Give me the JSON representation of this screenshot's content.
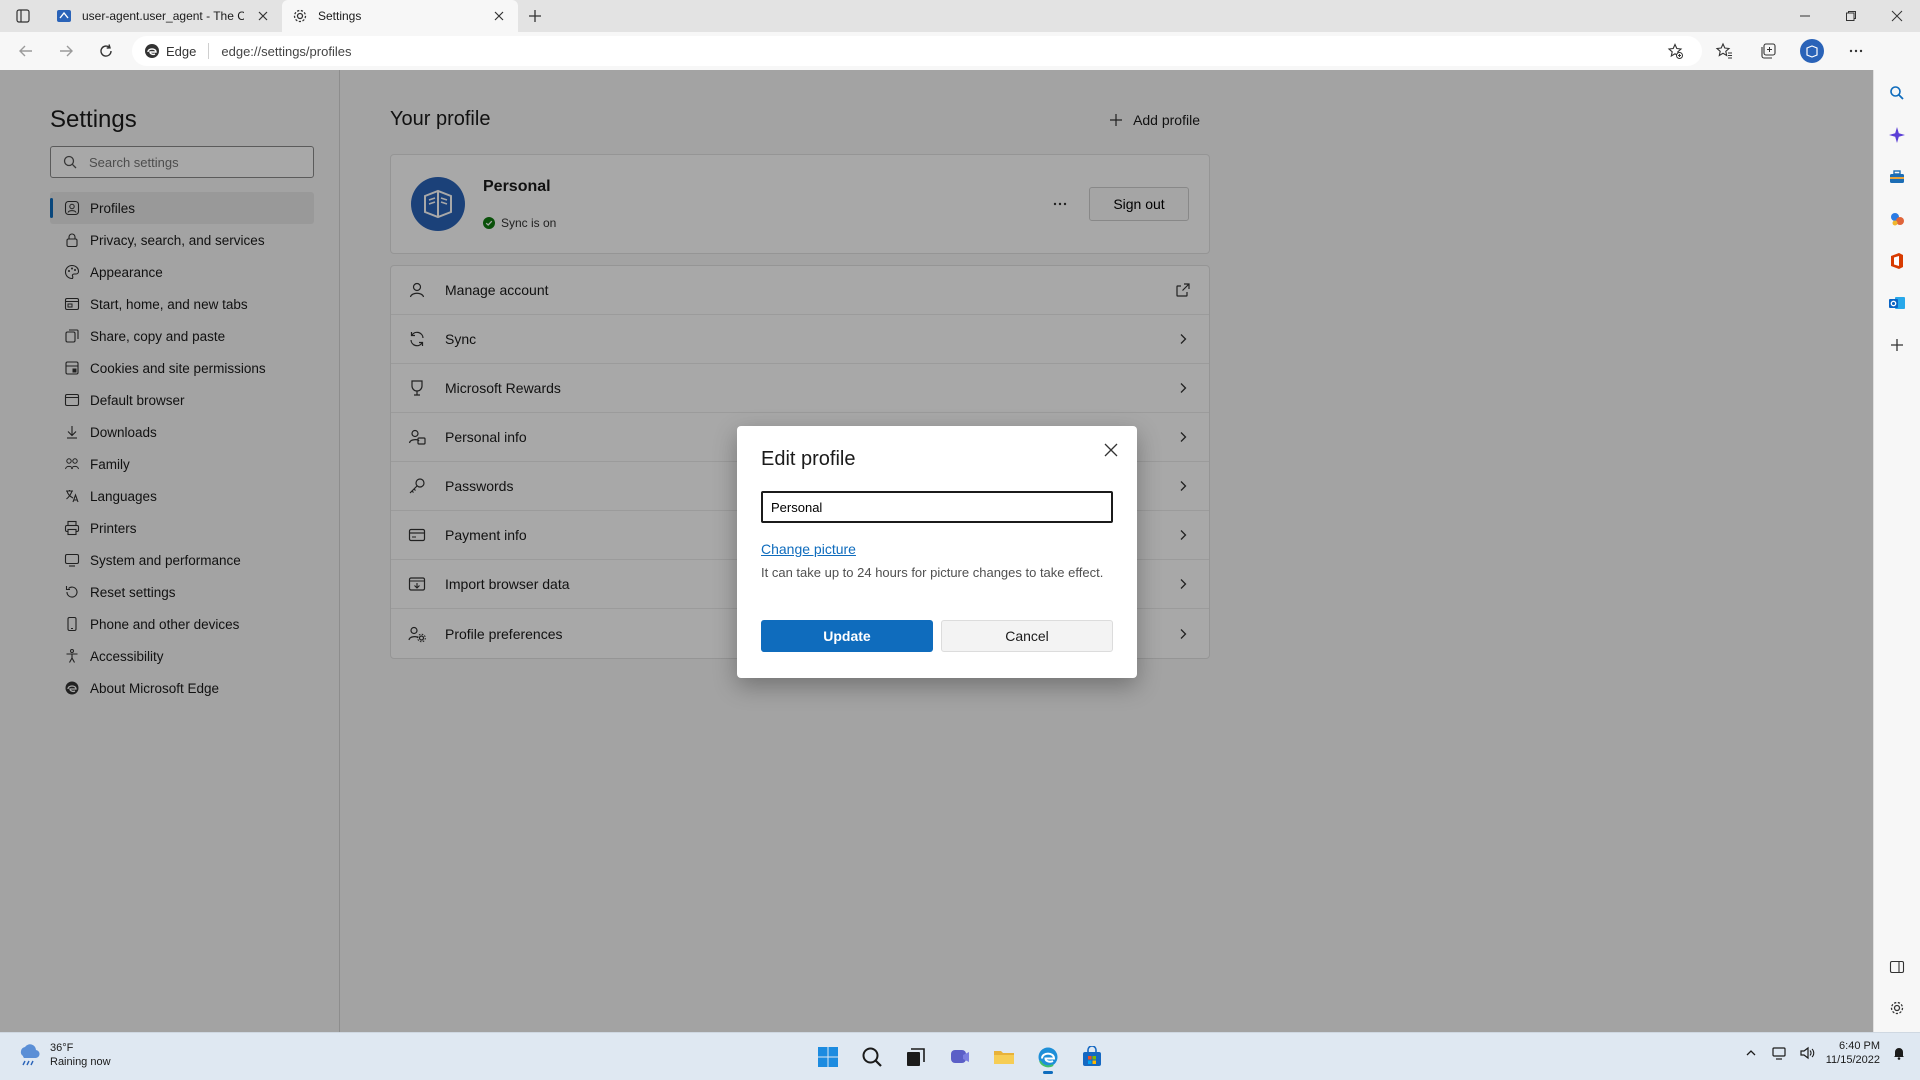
{
  "tabs": [
    {
      "title": "user-agent.user_agent - The Col",
      "active": false
    },
    {
      "title": "Settings",
      "active": true
    }
  ],
  "toolbar": {
    "site_chip": "Edge",
    "url": "edge://settings/profiles"
  },
  "sidebar": {
    "title": "Settings",
    "search_placeholder": "Search settings",
    "items": [
      {
        "label": "Profiles",
        "icon": "profile-icon",
        "active": true
      },
      {
        "label": "Privacy, search, and services",
        "icon": "lock-icon"
      },
      {
        "label": "Appearance",
        "icon": "appearance-icon"
      },
      {
        "label": "Start, home, and new tabs",
        "icon": "home-tabs-icon"
      },
      {
        "label": "Share, copy and paste",
        "icon": "share-icon"
      },
      {
        "label": "Cookies and site permissions",
        "icon": "cookies-icon"
      },
      {
        "label": "Default browser",
        "icon": "browser-icon"
      },
      {
        "label": "Downloads",
        "icon": "download-icon"
      },
      {
        "label": "Family",
        "icon": "family-icon"
      },
      {
        "label": "Languages",
        "icon": "languages-icon"
      },
      {
        "label": "Printers",
        "icon": "printer-icon"
      },
      {
        "label": "System and performance",
        "icon": "system-icon"
      },
      {
        "label": "Reset settings",
        "icon": "reset-icon"
      },
      {
        "label": "Phone and other devices",
        "icon": "phone-icon"
      },
      {
        "label": "Accessibility",
        "icon": "accessibility-icon"
      },
      {
        "label": "About Microsoft Edge",
        "icon": "edge-logo-icon"
      }
    ]
  },
  "main": {
    "heading": "Your profile",
    "add_profile_label": "Add profile",
    "profile": {
      "name": "Personal",
      "sync_status": "Sync is on",
      "sign_out_label": "Sign out"
    },
    "rows": [
      {
        "label": "Manage account",
        "icon": "person-icon",
        "trailing": "external-link-icon"
      },
      {
        "label": "Sync",
        "icon": "sync-icon",
        "trailing": "chevron-right-icon"
      },
      {
        "label": "Microsoft Rewards",
        "icon": "rewards-icon",
        "trailing": "chevron-right-icon"
      },
      {
        "label": "Personal info",
        "icon": "personal-info-icon",
        "trailing": "chevron-right-icon"
      },
      {
        "label": "Passwords",
        "icon": "key-icon",
        "trailing": "chevron-right-icon"
      },
      {
        "label": "Payment info",
        "icon": "card-icon",
        "trailing": "chevron-right-icon"
      },
      {
        "label": "Import browser data",
        "icon": "import-icon",
        "trailing": "chevron-right-icon"
      },
      {
        "label": "Profile preferences",
        "icon": "preferences-icon",
        "trailing": "chevron-right-icon"
      }
    ]
  },
  "dialog": {
    "title": "Edit profile",
    "name_value": "Personal",
    "change_picture_label": "Change picture",
    "note": "It can take up to 24 hours for picture changes to take effect.",
    "update_label": "Update",
    "cancel_label": "Cancel"
  },
  "taskbar": {
    "weather_temp": "36°F",
    "weather_desc": "Raining now",
    "time": "6:40 PM",
    "date": "11/15/2022"
  },
  "colors": {
    "accent": "#0f6cbd",
    "sync_ok": "#107c10"
  }
}
